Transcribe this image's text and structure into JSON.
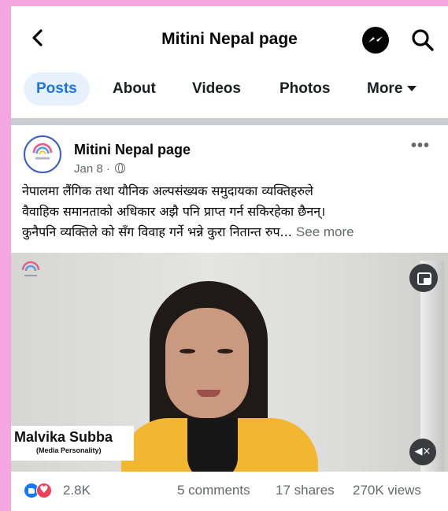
{
  "header": {
    "title": "Mitini Nepal page",
    "back_icon": "chevron-left-icon",
    "messenger_icon": "messenger-icon",
    "search_icon": "search-icon"
  },
  "tabs": [
    {
      "label": "Posts",
      "active": true
    },
    {
      "label": "About",
      "active": false
    },
    {
      "label": "Videos",
      "active": false
    },
    {
      "label": "Photos",
      "active": false
    },
    {
      "label": "More",
      "active": false
    }
  ],
  "post": {
    "author": "Mitini Nepal page",
    "date": "Jan 8 ·",
    "text_lines": [
      "नेपालमा लैंगिक तथा यौनिक अल्पसंख्यक समुदायका व्यक्तिहरुले",
      "वैवाहिक समानताको अधिकार अझै पनि प्राप्त गर्न सकिरहेका छैनन्।",
      "कुनैपनि व्यक्तिले को सँग विवाह गर्ने भन्ने कुरा नितान्त रुप..."
    ],
    "see_more": "See more",
    "video": {
      "caption_name": "Malvika Subba",
      "caption_role": "(Media Personality)"
    },
    "stats": {
      "reactions": "2.8K",
      "comments": "5 comments",
      "shares": "17 shares",
      "views": "270K views"
    }
  },
  "colors": {
    "accent": "#1b74e4",
    "active_tab_bg": "#e7f0fd",
    "page_frame": "#f4a6e3",
    "like": "#1877f2",
    "love": "#f33e58"
  }
}
